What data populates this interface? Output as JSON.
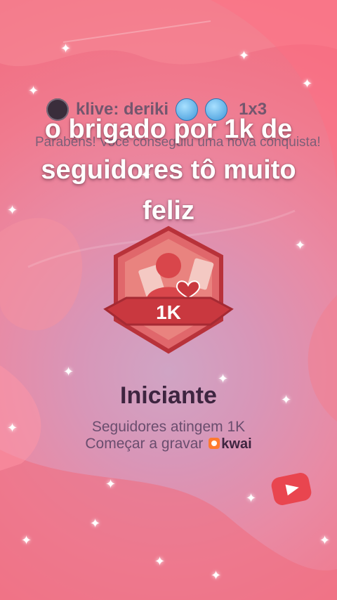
{
  "post": {
    "username": "klive: deriki",
    "counter": "1x3",
    "congrats": "Parabéns! Você conseguiu uma nova conquista!"
  },
  "caption": {
    "line1": "o brigado por 1k de",
    "line2": "seguidores tô muito",
    "line3": "feliz"
  },
  "achievement": {
    "badge_value": "1K",
    "title": "Iniciante",
    "subtitle": "Seguidores atingem 1K",
    "cta": "Começar a gravar",
    "brand": "kwai"
  },
  "icons": {
    "avatar": "avatar-icon",
    "emoji": "cold-face-emoji-icon",
    "badge": "follower-badge-icon",
    "play": "play-button-icon",
    "sparkle": "sparkle-icon"
  },
  "colors": {
    "background": "#f07a8e",
    "badge_red": "#c9383f",
    "title": "#3e2540"
  }
}
